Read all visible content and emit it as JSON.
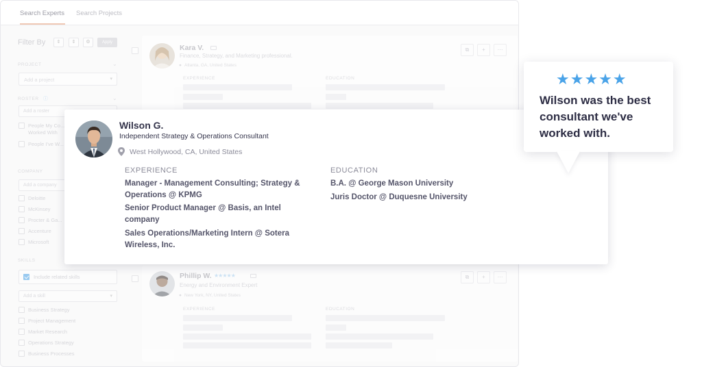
{
  "tabs": [
    {
      "label": "Search Experts",
      "active": true
    },
    {
      "label": "Search Projects",
      "active": false
    }
  ],
  "sidebar": {
    "filter_title": "Filter By",
    "apply_label": "Apply",
    "project": {
      "title": "PROJECT",
      "placeholder": "Add a project"
    },
    "roster": {
      "title": "ROSTER",
      "placeholder": "Add a roster",
      "options": [
        "People My Co... Worked With",
        "People I've W..."
      ]
    },
    "company": {
      "title": "COMPANY",
      "placeholder": "Add a company",
      "options": [
        "Deloitte",
        "McKinsey",
        "Procter & Ga...",
        "Accenture",
        "Microsoft"
      ]
    },
    "skills": {
      "title": "SKILLS",
      "include_related": "Include related skills",
      "include_related_checked": true,
      "placeholder": "Add a skill",
      "options": [
        "Business Strategy",
        "Project Management",
        "Market Research",
        "Operations Strategy",
        "Business Processes"
      ]
    }
  },
  "experts": [
    {
      "name": "Kara V.",
      "headline": "Finance, Strategy, and Marketing professional.",
      "location": "Atlanta, GA, United States",
      "experience_label": "EXPERIENCE",
      "education_label": "EDUCATION"
    },
    {
      "name": "Phillip W.",
      "rating_stars": "★★★★★",
      "rating": 5,
      "headline": "Energy and Environment Expert",
      "location": "New York, NY, United States",
      "experience_label": "EXPERIENCE",
      "education_label": "EDUCATION"
    }
  ],
  "highlight": {
    "name": "Wilson G.",
    "headline": "Independent Strategy & Operations Consultant",
    "location": "West Hollywood, CA, United States",
    "experience_label": "EXPERIENCE",
    "education_label": "EDUCATION",
    "experience": [
      "Manager - Management Consulting; Strategy & Operations @ KPMG",
      "Senior Product Manager @ Basis, an Intel company",
      "Sales Operations/Marketing Intern @ Sotera Wireless, Inc."
    ],
    "education": [
      "B.A. @ George Mason University",
      "Juris Doctor @ Duquesne University"
    ]
  },
  "testimonial": {
    "stars": "★★★★★",
    "rating": 5,
    "text": "Wilson was the best consultant we've worked with."
  },
  "colors": {
    "accent": "#4aa3e8",
    "active_tab_underline": "#f0c8b4",
    "heading_text": "#2d2d44"
  },
  "icons": [
    "pin-icon",
    "info-icon",
    "open-icon",
    "add-user-icon",
    "more-icon",
    "chevron-down-icon",
    "sort-icon",
    "gear-icon",
    "star-icon",
    "tag-icon"
  ]
}
